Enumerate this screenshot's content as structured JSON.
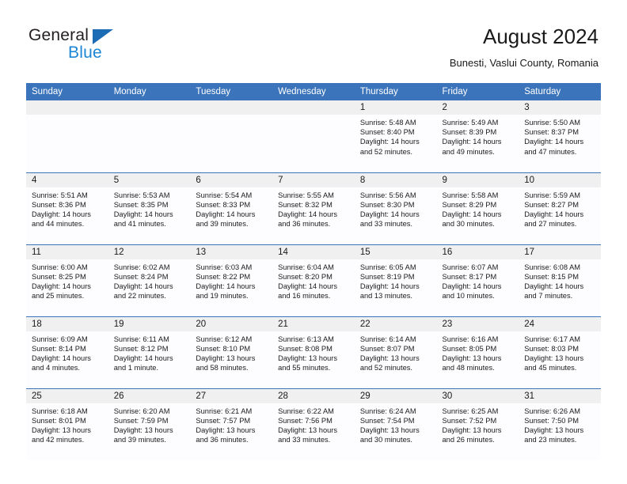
{
  "brand": {
    "name_part1": "General",
    "name_part2": "Blue",
    "logo_color": "#1b6cb5",
    "logo_text_color": "#1b85d6"
  },
  "header": {
    "title": "August 2024",
    "subtitle": "Bunesti, Vaslui County, Romania"
  },
  "theme": {
    "header_blue": "#3b74ba",
    "daynum_band": "#f0f0f0",
    "cell_bg": "#fdfdff"
  },
  "weekdays": [
    "Sunday",
    "Monday",
    "Tuesday",
    "Wednesday",
    "Thursday",
    "Friday",
    "Saturday"
  ],
  "weeks": [
    [
      {
        "day": "",
        "sunrise": "",
        "sunset": "",
        "daylight1": "",
        "daylight2": ""
      },
      {
        "day": "",
        "sunrise": "",
        "sunset": "",
        "daylight1": "",
        "daylight2": ""
      },
      {
        "day": "",
        "sunrise": "",
        "sunset": "",
        "daylight1": "",
        "daylight2": ""
      },
      {
        "day": "",
        "sunrise": "",
        "sunset": "",
        "daylight1": "",
        "daylight2": ""
      },
      {
        "day": "1",
        "sunrise": "Sunrise: 5:48 AM",
        "sunset": "Sunset: 8:40 PM",
        "daylight1": "Daylight: 14 hours",
        "daylight2": "and 52 minutes."
      },
      {
        "day": "2",
        "sunrise": "Sunrise: 5:49 AM",
        "sunset": "Sunset: 8:39 PM",
        "daylight1": "Daylight: 14 hours",
        "daylight2": "and 49 minutes."
      },
      {
        "day": "3",
        "sunrise": "Sunrise: 5:50 AM",
        "sunset": "Sunset: 8:37 PM",
        "daylight1": "Daylight: 14 hours",
        "daylight2": "and 47 minutes."
      }
    ],
    [
      {
        "day": "4",
        "sunrise": "Sunrise: 5:51 AM",
        "sunset": "Sunset: 8:36 PM",
        "daylight1": "Daylight: 14 hours",
        "daylight2": "and 44 minutes."
      },
      {
        "day": "5",
        "sunrise": "Sunrise: 5:53 AM",
        "sunset": "Sunset: 8:35 PM",
        "daylight1": "Daylight: 14 hours",
        "daylight2": "and 41 minutes."
      },
      {
        "day": "6",
        "sunrise": "Sunrise: 5:54 AM",
        "sunset": "Sunset: 8:33 PM",
        "daylight1": "Daylight: 14 hours",
        "daylight2": "and 39 minutes."
      },
      {
        "day": "7",
        "sunrise": "Sunrise: 5:55 AM",
        "sunset": "Sunset: 8:32 PM",
        "daylight1": "Daylight: 14 hours",
        "daylight2": "and 36 minutes."
      },
      {
        "day": "8",
        "sunrise": "Sunrise: 5:56 AM",
        "sunset": "Sunset: 8:30 PM",
        "daylight1": "Daylight: 14 hours",
        "daylight2": "and 33 minutes."
      },
      {
        "day": "9",
        "sunrise": "Sunrise: 5:58 AM",
        "sunset": "Sunset: 8:29 PM",
        "daylight1": "Daylight: 14 hours",
        "daylight2": "and 30 minutes."
      },
      {
        "day": "10",
        "sunrise": "Sunrise: 5:59 AM",
        "sunset": "Sunset: 8:27 PM",
        "daylight1": "Daylight: 14 hours",
        "daylight2": "and 27 minutes."
      }
    ],
    [
      {
        "day": "11",
        "sunrise": "Sunrise: 6:00 AM",
        "sunset": "Sunset: 8:25 PM",
        "daylight1": "Daylight: 14 hours",
        "daylight2": "and 25 minutes."
      },
      {
        "day": "12",
        "sunrise": "Sunrise: 6:02 AM",
        "sunset": "Sunset: 8:24 PM",
        "daylight1": "Daylight: 14 hours",
        "daylight2": "and 22 minutes."
      },
      {
        "day": "13",
        "sunrise": "Sunrise: 6:03 AM",
        "sunset": "Sunset: 8:22 PM",
        "daylight1": "Daylight: 14 hours",
        "daylight2": "and 19 minutes."
      },
      {
        "day": "14",
        "sunrise": "Sunrise: 6:04 AM",
        "sunset": "Sunset: 8:20 PM",
        "daylight1": "Daylight: 14 hours",
        "daylight2": "and 16 minutes."
      },
      {
        "day": "15",
        "sunrise": "Sunrise: 6:05 AM",
        "sunset": "Sunset: 8:19 PM",
        "daylight1": "Daylight: 14 hours",
        "daylight2": "and 13 minutes."
      },
      {
        "day": "16",
        "sunrise": "Sunrise: 6:07 AM",
        "sunset": "Sunset: 8:17 PM",
        "daylight1": "Daylight: 14 hours",
        "daylight2": "and 10 minutes."
      },
      {
        "day": "17",
        "sunrise": "Sunrise: 6:08 AM",
        "sunset": "Sunset: 8:15 PM",
        "daylight1": "Daylight: 14 hours",
        "daylight2": "and 7 minutes."
      }
    ],
    [
      {
        "day": "18",
        "sunrise": "Sunrise: 6:09 AM",
        "sunset": "Sunset: 8:14 PM",
        "daylight1": "Daylight: 14 hours",
        "daylight2": "and 4 minutes."
      },
      {
        "day": "19",
        "sunrise": "Sunrise: 6:11 AM",
        "sunset": "Sunset: 8:12 PM",
        "daylight1": "Daylight: 14 hours",
        "daylight2": "and 1 minute."
      },
      {
        "day": "20",
        "sunrise": "Sunrise: 6:12 AM",
        "sunset": "Sunset: 8:10 PM",
        "daylight1": "Daylight: 13 hours",
        "daylight2": "and 58 minutes."
      },
      {
        "day": "21",
        "sunrise": "Sunrise: 6:13 AM",
        "sunset": "Sunset: 8:08 PM",
        "daylight1": "Daylight: 13 hours",
        "daylight2": "and 55 minutes."
      },
      {
        "day": "22",
        "sunrise": "Sunrise: 6:14 AM",
        "sunset": "Sunset: 8:07 PM",
        "daylight1": "Daylight: 13 hours",
        "daylight2": "and 52 minutes."
      },
      {
        "day": "23",
        "sunrise": "Sunrise: 6:16 AM",
        "sunset": "Sunset: 8:05 PM",
        "daylight1": "Daylight: 13 hours",
        "daylight2": "and 48 minutes."
      },
      {
        "day": "24",
        "sunrise": "Sunrise: 6:17 AM",
        "sunset": "Sunset: 8:03 PM",
        "daylight1": "Daylight: 13 hours",
        "daylight2": "and 45 minutes."
      }
    ],
    [
      {
        "day": "25",
        "sunrise": "Sunrise: 6:18 AM",
        "sunset": "Sunset: 8:01 PM",
        "daylight1": "Daylight: 13 hours",
        "daylight2": "and 42 minutes."
      },
      {
        "day": "26",
        "sunrise": "Sunrise: 6:20 AM",
        "sunset": "Sunset: 7:59 PM",
        "daylight1": "Daylight: 13 hours",
        "daylight2": "and 39 minutes."
      },
      {
        "day": "27",
        "sunrise": "Sunrise: 6:21 AM",
        "sunset": "Sunset: 7:57 PM",
        "daylight1": "Daylight: 13 hours",
        "daylight2": "and 36 minutes."
      },
      {
        "day": "28",
        "sunrise": "Sunrise: 6:22 AM",
        "sunset": "Sunset: 7:56 PM",
        "daylight1": "Daylight: 13 hours",
        "daylight2": "and 33 minutes."
      },
      {
        "day": "29",
        "sunrise": "Sunrise: 6:24 AM",
        "sunset": "Sunset: 7:54 PM",
        "daylight1": "Daylight: 13 hours",
        "daylight2": "and 30 minutes."
      },
      {
        "day": "30",
        "sunrise": "Sunrise: 6:25 AM",
        "sunset": "Sunset: 7:52 PM",
        "daylight1": "Daylight: 13 hours",
        "daylight2": "and 26 minutes."
      },
      {
        "day": "31",
        "sunrise": "Sunrise: 6:26 AM",
        "sunset": "Sunset: 7:50 PM",
        "daylight1": "Daylight: 13 hours",
        "daylight2": "and 23 minutes."
      }
    ]
  ]
}
